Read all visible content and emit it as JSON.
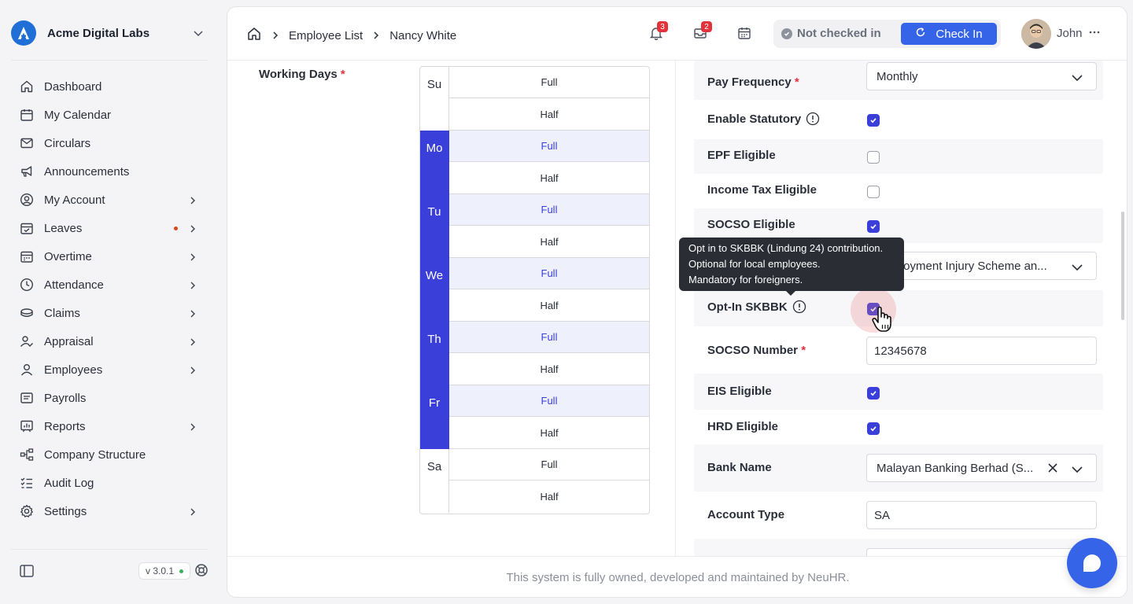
{
  "brand": {
    "name": "Acme Digital Labs"
  },
  "sidebar": {
    "items": [
      {
        "label": "Dashboard",
        "icon": "home-icon",
        "chevron": false
      },
      {
        "label": "My Calendar",
        "icon": "calendar-icon",
        "chevron": false
      },
      {
        "label": "Circulars",
        "icon": "mail-icon",
        "chevron": false
      },
      {
        "label": "Announcements",
        "icon": "megaphone-icon",
        "chevron": false
      },
      {
        "label": "My Account",
        "icon": "user-circle-icon",
        "chevron": true
      },
      {
        "label": "Leaves",
        "icon": "calendar-check-icon",
        "chevron": true,
        "dot": true
      },
      {
        "label": "Overtime",
        "icon": "calendar-clock-icon",
        "chevron": true
      },
      {
        "label": "Attendance",
        "icon": "clock-icon",
        "chevron": true
      },
      {
        "label": "Claims",
        "icon": "coins-icon",
        "chevron": true
      },
      {
        "label": "Appraisal",
        "icon": "user-check-icon",
        "chevron": true
      },
      {
        "label": "Employees",
        "icon": "user-icon",
        "chevron": true
      },
      {
        "label": "Payrolls",
        "icon": "receipt-icon",
        "chevron": false
      },
      {
        "label": "Reports",
        "icon": "report-icon",
        "chevron": true
      },
      {
        "label": "Company Structure",
        "icon": "org-structure-icon",
        "chevron": false
      },
      {
        "label": "Audit Log",
        "icon": "checklist-icon",
        "chevron": false
      },
      {
        "label": "Settings",
        "icon": "gear-icon",
        "chevron": true
      }
    ],
    "version": "v 3.0.1"
  },
  "breadcrumb": {
    "first": "Employee List",
    "current": "Nancy White"
  },
  "topbar": {
    "notifications_count": "3",
    "messages_count": "2",
    "status": "Not checked in",
    "checkin_label": "Check In",
    "user_name": "John"
  },
  "working_days": {
    "label": "Working Days",
    "days": [
      {
        "day": "Su",
        "full": "Full",
        "half": "Half",
        "on": false
      },
      {
        "day": "Mo",
        "full": "Full",
        "half": "Half",
        "on": true
      },
      {
        "day": "Tu",
        "full": "Full",
        "half": "Half",
        "on": true
      },
      {
        "day": "We",
        "full": "Full",
        "half": "Half",
        "on": true
      },
      {
        "day": "Th",
        "full": "Full",
        "half": "Half",
        "on": true
      },
      {
        "day": "Fr",
        "full": "Full",
        "half": "Half",
        "on": true
      },
      {
        "day": "Sa",
        "full": "Full",
        "half": "Half",
        "on": false
      }
    ]
  },
  "form": {
    "pay_frequency": {
      "label": "Pay Frequency",
      "value": "Monthly"
    },
    "enable_statutory": {
      "label": "Enable Statutory",
      "checked": true
    },
    "epf_eligible": {
      "label": "EPF Eligible",
      "checked": false
    },
    "income_tax_eligible": {
      "label": "Income Tax Eligible",
      "checked": false
    },
    "socso_eligible": {
      "label": "SOCSO Eligible",
      "checked": true
    },
    "socso_scheme": {
      "value": "Employment Injury Scheme an..."
    },
    "opt_in_skbbk": {
      "label": "Opt-In SKBBK",
      "checked": true
    },
    "socso_number": {
      "label": "SOCSO Number",
      "value": "12345678"
    },
    "eis_eligible": {
      "label": "EIS Eligible",
      "checked": true
    },
    "hrd_eligible": {
      "label": "HRD Eligible",
      "checked": true
    },
    "bank_name": {
      "label": "Bank Name",
      "value": "Malayan Banking Berhad (S..."
    },
    "account_type": {
      "label": "Account Type",
      "value": "SA"
    }
  },
  "tooltip": {
    "line1": "Opt in to SKBBK (Lindung 24) contribution.",
    "line2": "Optional for local employees.",
    "line3": "Mandatory for foreigners."
  },
  "footer": {
    "text": "This system is fully owned, developed and maintained by NeuHR."
  },
  "colors": {
    "accent": "#3b3fd9",
    "button": "#3564e8",
    "badge": "#e2333b"
  }
}
